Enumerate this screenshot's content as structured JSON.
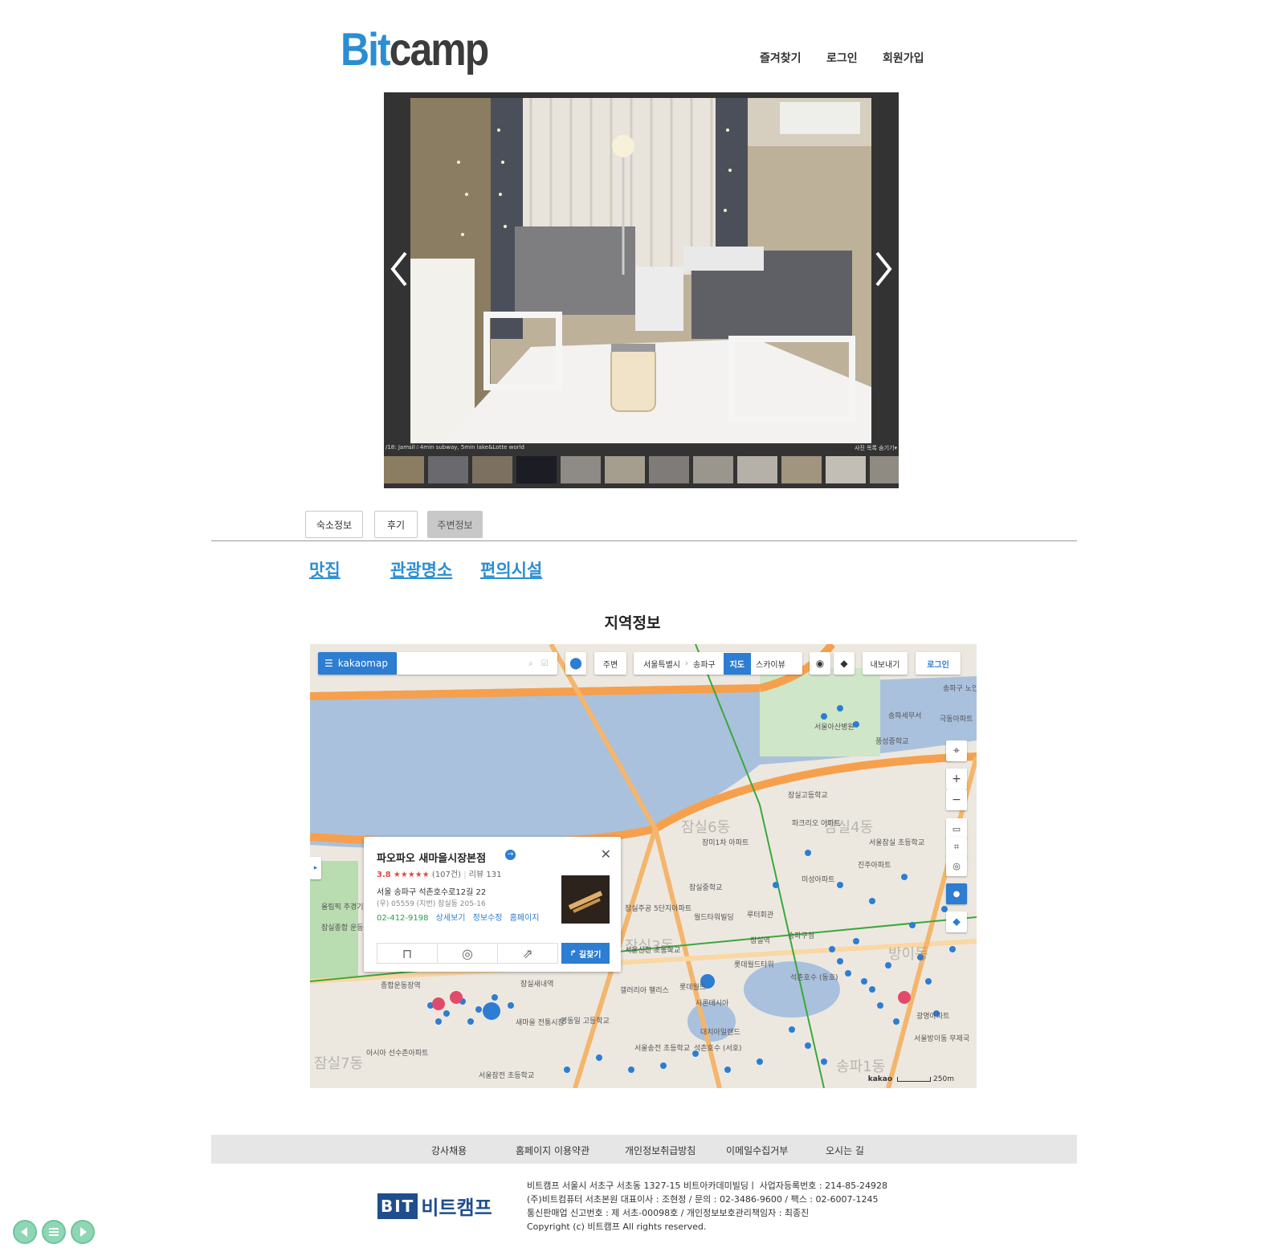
{
  "header": {
    "logo_part1": "Bit",
    "logo_part2": "camp",
    "nav": [
      "즐겨찾기",
      "로그인",
      "회원가입"
    ]
  },
  "gallery": {
    "caption_left": "/18: Jamsil☆4min subway, 5min lake&Lotte world",
    "caption_right": "사진 목록 숨기기▾",
    "thumb_count": 12
  },
  "tabs": [
    "숙소정보",
    "후기",
    "주변정보"
  ],
  "active_tab": "주변정보",
  "categories": [
    "맛집",
    "관광명소",
    "편의시설"
  ],
  "region_title": "지역정보",
  "map": {
    "brand": "kakaomap",
    "search_placeholder": "",
    "nearby_btn": "주변",
    "breadcrumb": [
      "서울특별시",
      "송파구"
    ],
    "view_map": "지도",
    "view_sky": "스카이뷰",
    "export_btn": "내보내기",
    "login_btn": "로그인",
    "popup": {
      "name": "파오파오 새마을시장본점",
      "rating": "3.8",
      "stars": "★★★★★",
      "rating_count": "(107건)",
      "review": "리뷰 131",
      "address": "서울 송파구 석촌호수로12길 22",
      "address_old": "(우) 05559  (지번) 잠실동 205-16",
      "phone": "02-412-9198",
      "links": [
        "상세보기",
        "정보수정",
        "홈페이지"
      ],
      "route_btn": "길찾기"
    },
    "scale": "250m",
    "copyright": "kakao",
    "labels": [
      "잠실고등학교",
      "파크리오 아파트",
      "서울잠실 초등학교",
      "진주아파트",
      "미성아파트",
      "잠실중학교",
      "장미1차 아파트",
      "잠실주공 5단지아파트",
      "월드타워빌딩",
      "루터회관",
      "잠실역",
      "송파구청",
      "롯데월드타워",
      "석촌호수 (동호)",
      "롯데월드",
      "사론데시아",
      "대치아일랜드",
      "석촌호수 (서호)",
      "영동일 고등학교",
      "서울송전 초등학교",
      "잠실새내역",
      "종합운동장역",
      "올림픽 주경기장",
      "잠실종합 운동장",
      "서울잠전 초등학교",
      "아시아 선수촌아파트",
      "새마을 전통시장",
      "갤러리아 팰리스",
      "서울신천 초등학교",
      "송파세무서",
      "서울아산병원",
      "풍성중학교",
      "광명아파트",
      "서울방이동 무제국",
      "극동아파트",
      "송파구 노인센터"
    ],
    "big_labels": [
      "잠실6동",
      "잠실4동",
      "잠실3동",
      "잠실7동",
      "송파1동",
      "방이동"
    ]
  },
  "footer": {
    "links": [
      "강사채용",
      "홈페이지 이용약관",
      "개인정보취급방침",
      "이메일수집거부",
      "오시는 길"
    ],
    "logo_mark": "BIT",
    "logo_text": "비트캠프",
    "info": [
      "비트캠프 서울시 서초구 서초동 1327-15 비트아카데미빌딩ㅣ 사업자등록번호 : 214-85-24928",
      "(주)비트컴퓨터 서초본원 대표이사 : 조현정 / 문의 : 02-3486-9600 / 팩스 : 02-6007-1245",
      "통신판매업 신고번호 : 제 서초-00098호 / 개인정보보호관리책임자 : 최종진",
      "Copyright (c) 비트캠프 All rights reserved."
    ]
  },
  "colors": {
    "brand_blue": "#2b8ed3",
    "kakao_blue": "#2d7dd2",
    "water": "#a9c1dd",
    "road": "#f6a04d",
    "green": "#a8d6a0",
    "footer_btn": "#8fd6b5"
  }
}
